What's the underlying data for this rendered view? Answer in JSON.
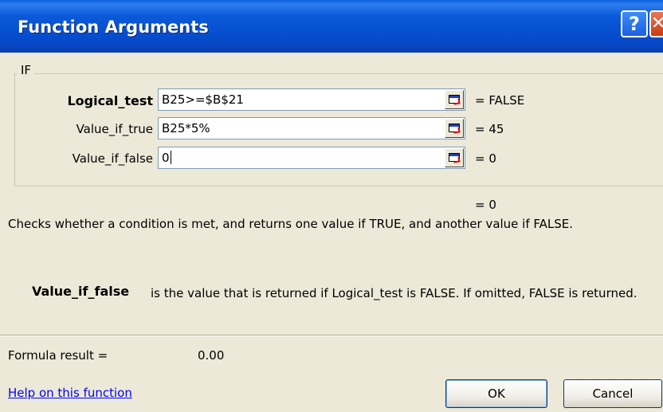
{
  "window": {
    "title": "Function Arguments",
    "help_glyph": "?",
    "close_glyph": "✕"
  },
  "group": {
    "label": "IF",
    "args": [
      {
        "name": "Logical_test",
        "value": "B25>=$B$21",
        "result": "= FALSE"
      },
      {
        "name": "Value_if_true",
        "value": "B25*5%",
        "result": "= 45"
      },
      {
        "name": "Value_if_false",
        "value": "0",
        "result": "= 0"
      }
    ]
  },
  "overall_result": "= 0",
  "description": "Checks whether a condition is met, and returns one value if TRUE, and another value if FALSE.",
  "param_help": {
    "name": "Value_if_false",
    "text": "is the value that is returned if Logical_test is FALSE. If omitted, FALSE is returned."
  },
  "formula_result": {
    "label": "Formula result =",
    "value": "0.00"
  },
  "help_link": "Help on this function",
  "buttons": {
    "ok": "OK",
    "cancel": "Cancel"
  },
  "colors": {
    "titlebar": "#0650d2",
    "dialog_bg": "#ece9d8",
    "link": "#0000ff"
  },
  "icons": [
    "help-icon",
    "close-icon",
    "collapse-dialog-icon"
  ]
}
